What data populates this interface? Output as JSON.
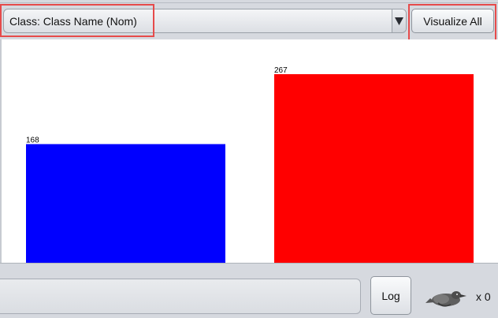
{
  "toolbar": {
    "class_selector": {
      "selected": "Class: Class Name (Nom)",
      "icon": "chevron-down-icon"
    },
    "visualize_all_label": "Visualize All"
  },
  "colors": {
    "highlight": "#e64b4b",
    "background": "#d6d9df",
    "plot_background": "#ffffff"
  },
  "chart_data": {
    "type": "bar",
    "categories": [
      "",
      ""
    ],
    "values": [
      168,
      267
    ],
    "colors": [
      "#0000ff",
      "#ff0000"
    ],
    "data_labels": [
      "168",
      "267"
    ],
    "grid": false,
    "title": "",
    "xlabel": "",
    "ylabel": ""
  },
  "status": {
    "log_label": "Log",
    "task_icon": "weka-bird-icon",
    "task_count": "x 0"
  }
}
